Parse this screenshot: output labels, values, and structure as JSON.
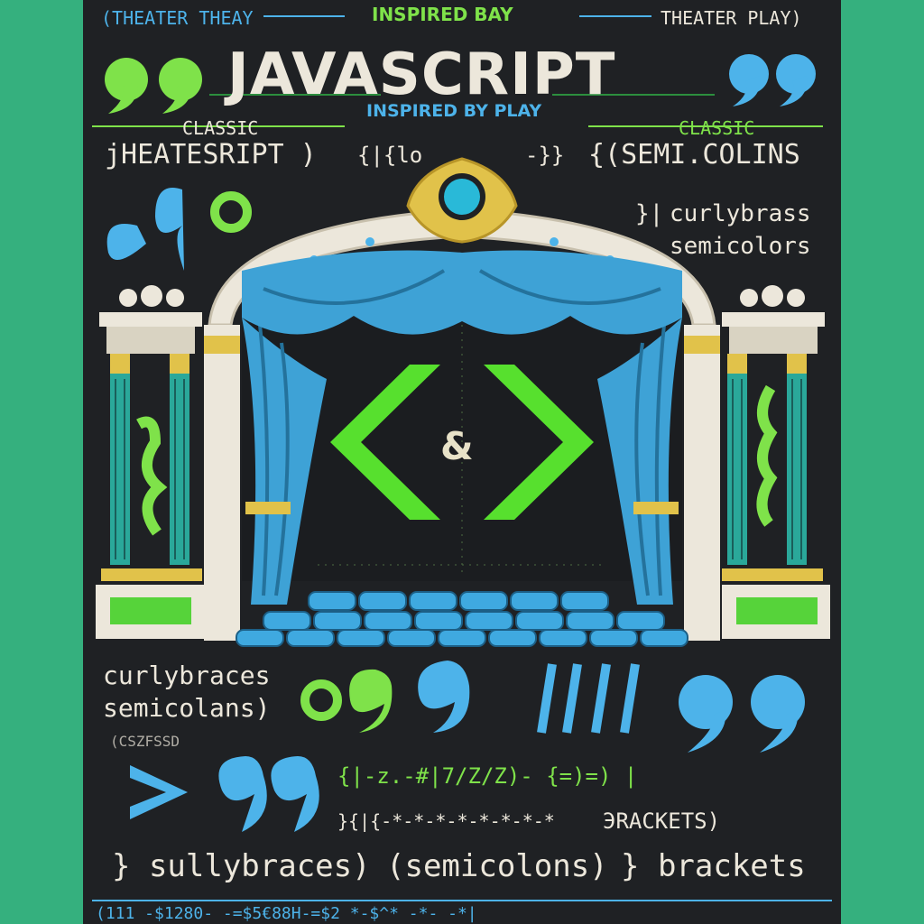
{
  "colors": {
    "page_background": "#35b07e",
    "poster_background": "#1f2124",
    "accent_green": "#7fe24a",
    "accent_blue": "#4db3ea",
    "cream": "#ece7db",
    "gold": "#e1c24a"
  },
  "header": {
    "top_left": "(THEATER THEAY",
    "top_center": "INSPIRED BAY",
    "top_right": "THEATER PLAY)",
    "title": "JAVASCRIPT",
    "subtitle": "INSPIRED BY PLAY",
    "classic_left": "CLASSIC",
    "classic_right": "CLASSIC",
    "line_left": "jHEATESRIPT )",
    "line_left_braces": "{|{lo",
    "line_mid_braces": "-}}",
    "line_right": "{(SEMI.COLINS"
  },
  "side_right": {
    "brace": "}|",
    "line1": "curlybrass",
    "line2": "semicolors"
  },
  "stage": {
    "ampersand": "&"
  },
  "bottom": {
    "line1": "curlybraces",
    "line2": "semicolans)",
    "code_row1": "{|-z.-#|7/Z/Z)- {=)=) |",
    "code_row2": "}{|{-*-*-*-*-*-*-*-*",
    "brackets_small": "ЭRACKETS)",
    "code_small": "(CSZFSSD",
    "footer_words": [
      "} sullybraces)",
      "(semicolons)",
      "} brackets"
    ],
    "footer_code": "(111 -$1280- -=$5€88H-=$2 *-$^* -*- -*|"
  },
  "icons": [
    "double-quote-icon",
    "greater-than-icon",
    "angle-bracket-icon",
    "theater-mask-icon"
  ]
}
